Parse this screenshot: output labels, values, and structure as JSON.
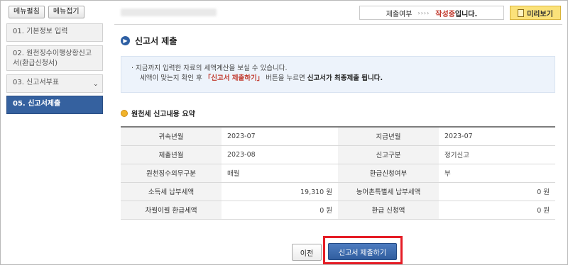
{
  "sidebar": {
    "menu_expand_label": "메뉴펼침",
    "menu_collapse_label": "메뉴접기",
    "steps": [
      {
        "label": "01. 기본정보 입력"
      },
      {
        "label": "02. 원천징수이행상황신고서(환급신청서)"
      },
      {
        "label": "03. 신고서부표"
      },
      {
        "label": "05. 신고서제출"
      }
    ]
  },
  "header": {
    "status_label": "제출여부",
    "status_arrows": "››››",
    "status_value": "작성중",
    "status_suffix": "입니다.",
    "preview_label": "미리보기"
  },
  "main": {
    "section_title": "신고서 제출",
    "info_line1": "· 지금까지 입력한 자료의 세액계산을 보실 수 있습니다.",
    "info_line2_a": "세액이 맞는지 확인 후 ",
    "info_line2_b": "「신고서 제출하기」",
    "info_line2_c": " 버튼을 누르면 ",
    "info_line2_d": "신고서가 최종제출 됩니다.",
    "summary_title": "원천세 신고내용 요약",
    "summary": {
      "row1": {
        "l1": "귀속년월",
        "v1": "2023-07",
        "l2": "지급년월",
        "v2": "2023-07"
      },
      "row2": {
        "l1": "제출년월",
        "v1": "2023-08",
        "l2": "신고구분",
        "v2": "정기신고"
      },
      "row3": {
        "l1": "원천징수의무구분",
        "v1": "매월",
        "l2": "환급신청여부",
        "v2": "부"
      },
      "row4": {
        "l1": "소득세 납부세액",
        "v1": "19,310 원",
        "l2": "농어촌특별세 납부세액",
        "v2": "0 원"
      },
      "row5": {
        "l1": "차월이월 환급세액",
        "v1": "0 원",
        "l2": "환급 신청액",
        "v2": "0 원"
      }
    },
    "prev_label": "이전",
    "submit_label": "신고서 제출하기"
  },
  "colors": {
    "accent": "#35619f",
    "highlight": "#e51d26",
    "status_red": "#c0372b",
    "preview_yellow": "#fbe27a"
  }
}
